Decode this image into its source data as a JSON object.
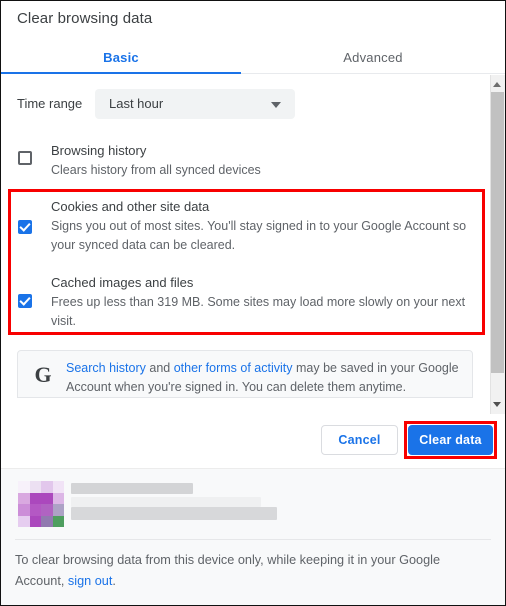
{
  "dialog": {
    "title": "Clear browsing data"
  },
  "tabs": [
    {
      "label": "Basic",
      "active": true
    },
    {
      "label": "Advanced",
      "active": false
    }
  ],
  "time_range": {
    "label": "Time range",
    "selected": "Last hour",
    "caret_icon": "chevron-down-icon"
  },
  "options": [
    {
      "id": "browsing-history",
      "title": "Browsing history",
      "description": "Clears history from all synced devices",
      "checked": false
    },
    {
      "id": "cookies-and-site-data",
      "title": "Cookies and other site data",
      "description": "Signs you out of most sites. You'll stay signed in to your Google Account so your synced data can be cleared.",
      "checked": true
    },
    {
      "id": "cached-images-and-files",
      "title": "Cached images and files",
      "description": "Frees up less than 319 MB. Some sites may load more slowly on your next visit.",
      "checked": true
    }
  ],
  "google_notice": {
    "logo_icon": "google-g-icon",
    "link1": "Search history",
    "mid": " and ",
    "link2": "other forms of activity",
    "rest": " may be saved in your Google Account when you're signed in. You can delete them anytime."
  },
  "buttons": {
    "cancel": "Cancel",
    "clear_data": "Clear data"
  },
  "footer": {
    "text_before": "To clear browsing data from this device only, while keeping it in your Google Account, ",
    "link": "sign out",
    "text_after": "."
  },
  "scrollbar": {
    "up_icon": "scroll-up-arrow-icon",
    "down_icon": "scroll-down-arrow-icon"
  },
  "annotations": {
    "highlight_color": "#f80000",
    "accent_color": "#1a73e8"
  }
}
